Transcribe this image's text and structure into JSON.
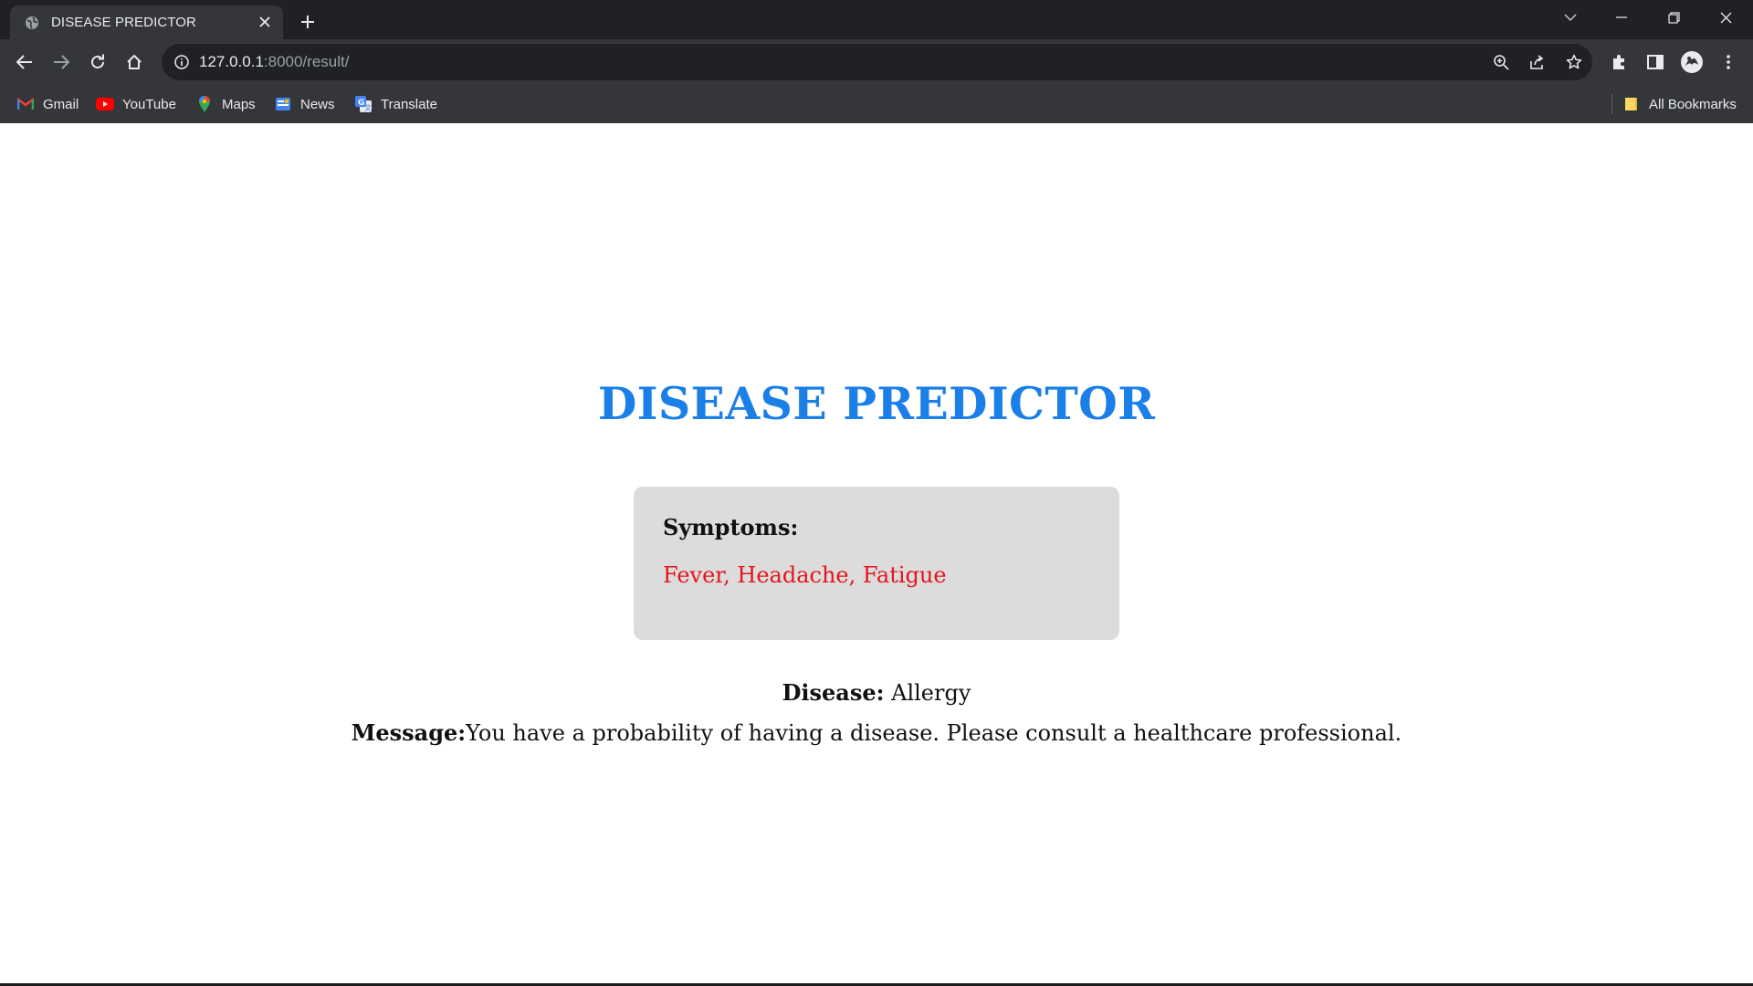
{
  "browser": {
    "tab": {
      "title": "DISEASE PREDICTOR"
    },
    "url": {
      "host": "127.0.0.1",
      "rest": ":8000/result/"
    },
    "bookmarks": [
      {
        "label": "Gmail",
        "icon": "gmail-icon"
      },
      {
        "label": "YouTube",
        "icon": "youtube-icon"
      },
      {
        "label": "Maps",
        "icon": "maps-icon"
      },
      {
        "label": "News",
        "icon": "news-icon"
      },
      {
        "label": "Translate",
        "icon": "translate-icon"
      }
    ],
    "all_bookmarks_label": "All Bookmarks"
  },
  "page": {
    "title": "DISEASE PREDICTOR",
    "symptoms": {
      "heading": "Symptoms:",
      "values": "Fever, Headache, Fatigue"
    },
    "disease": {
      "label": "Disease:",
      "value": " Allergy"
    },
    "message": {
      "label": "Message:",
      "value": "You have a probability of having a disease. Please consult a healthcare professional."
    }
  },
  "colors": {
    "title": "#1a7fe6",
    "symptoms_values": "#e4141b",
    "card_background": "#dcdcdc",
    "chrome_dark": "#202124",
    "chrome_toolbar": "#35363a"
  }
}
